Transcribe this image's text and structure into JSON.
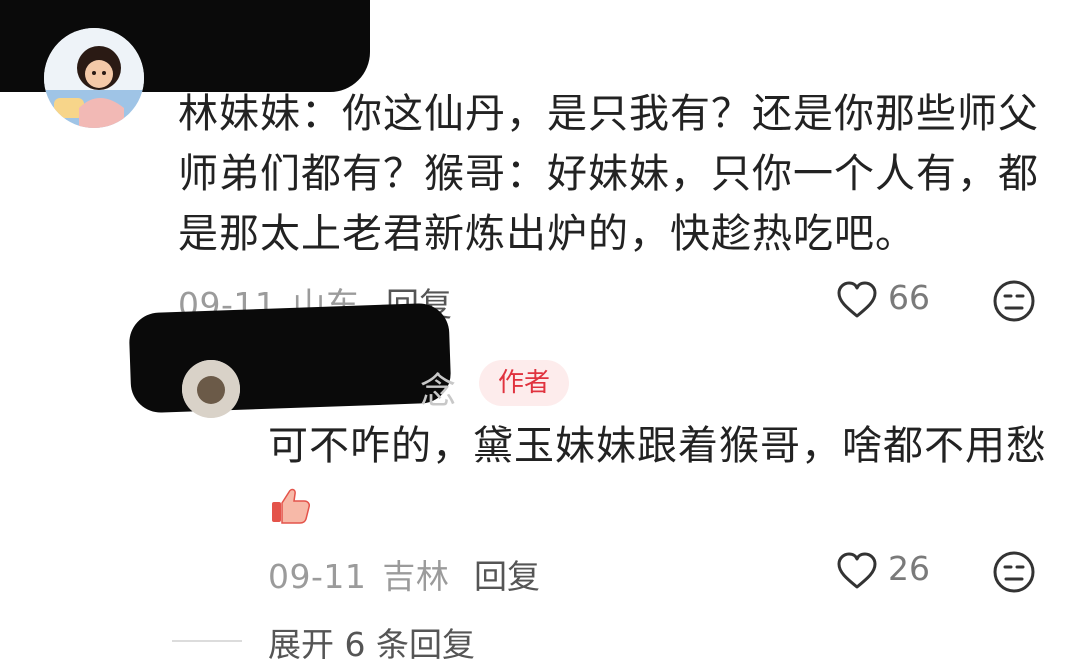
{
  "comments": [
    {
      "text_lines": [
        "林妹妹：你这仙丹，是只我有？还是你那些师父",
        "师弟们都有？猴哥：好妹妹，只你一个人有，都",
        "是那太上老君新炼出炉的，快趁热吃吧。"
      ],
      "date": "09-11",
      "location": "山东",
      "reply_label": "回复",
      "likes": "66",
      "like_icon": "heart-outline-icon",
      "dislike_icon": "neutral-face-icon"
    }
  ],
  "reply": {
    "name_fragment": "念",
    "badge": "作者",
    "text": "可不咋的，黛玉妹妹跟着猴哥，啥都不用愁",
    "emoji": "thumbs-up-emoji",
    "date": "09-11",
    "location": "吉林",
    "reply_label": "回复",
    "likes": "26",
    "like_icon": "heart-outline-icon",
    "dislike_icon": "neutral-face-icon"
  },
  "expand_replies": "展开 6 条回复",
  "colors": {
    "badge_bg": "#fdecec",
    "badge_text": "#e0333f",
    "meta_gray": "#9b9b9b"
  }
}
